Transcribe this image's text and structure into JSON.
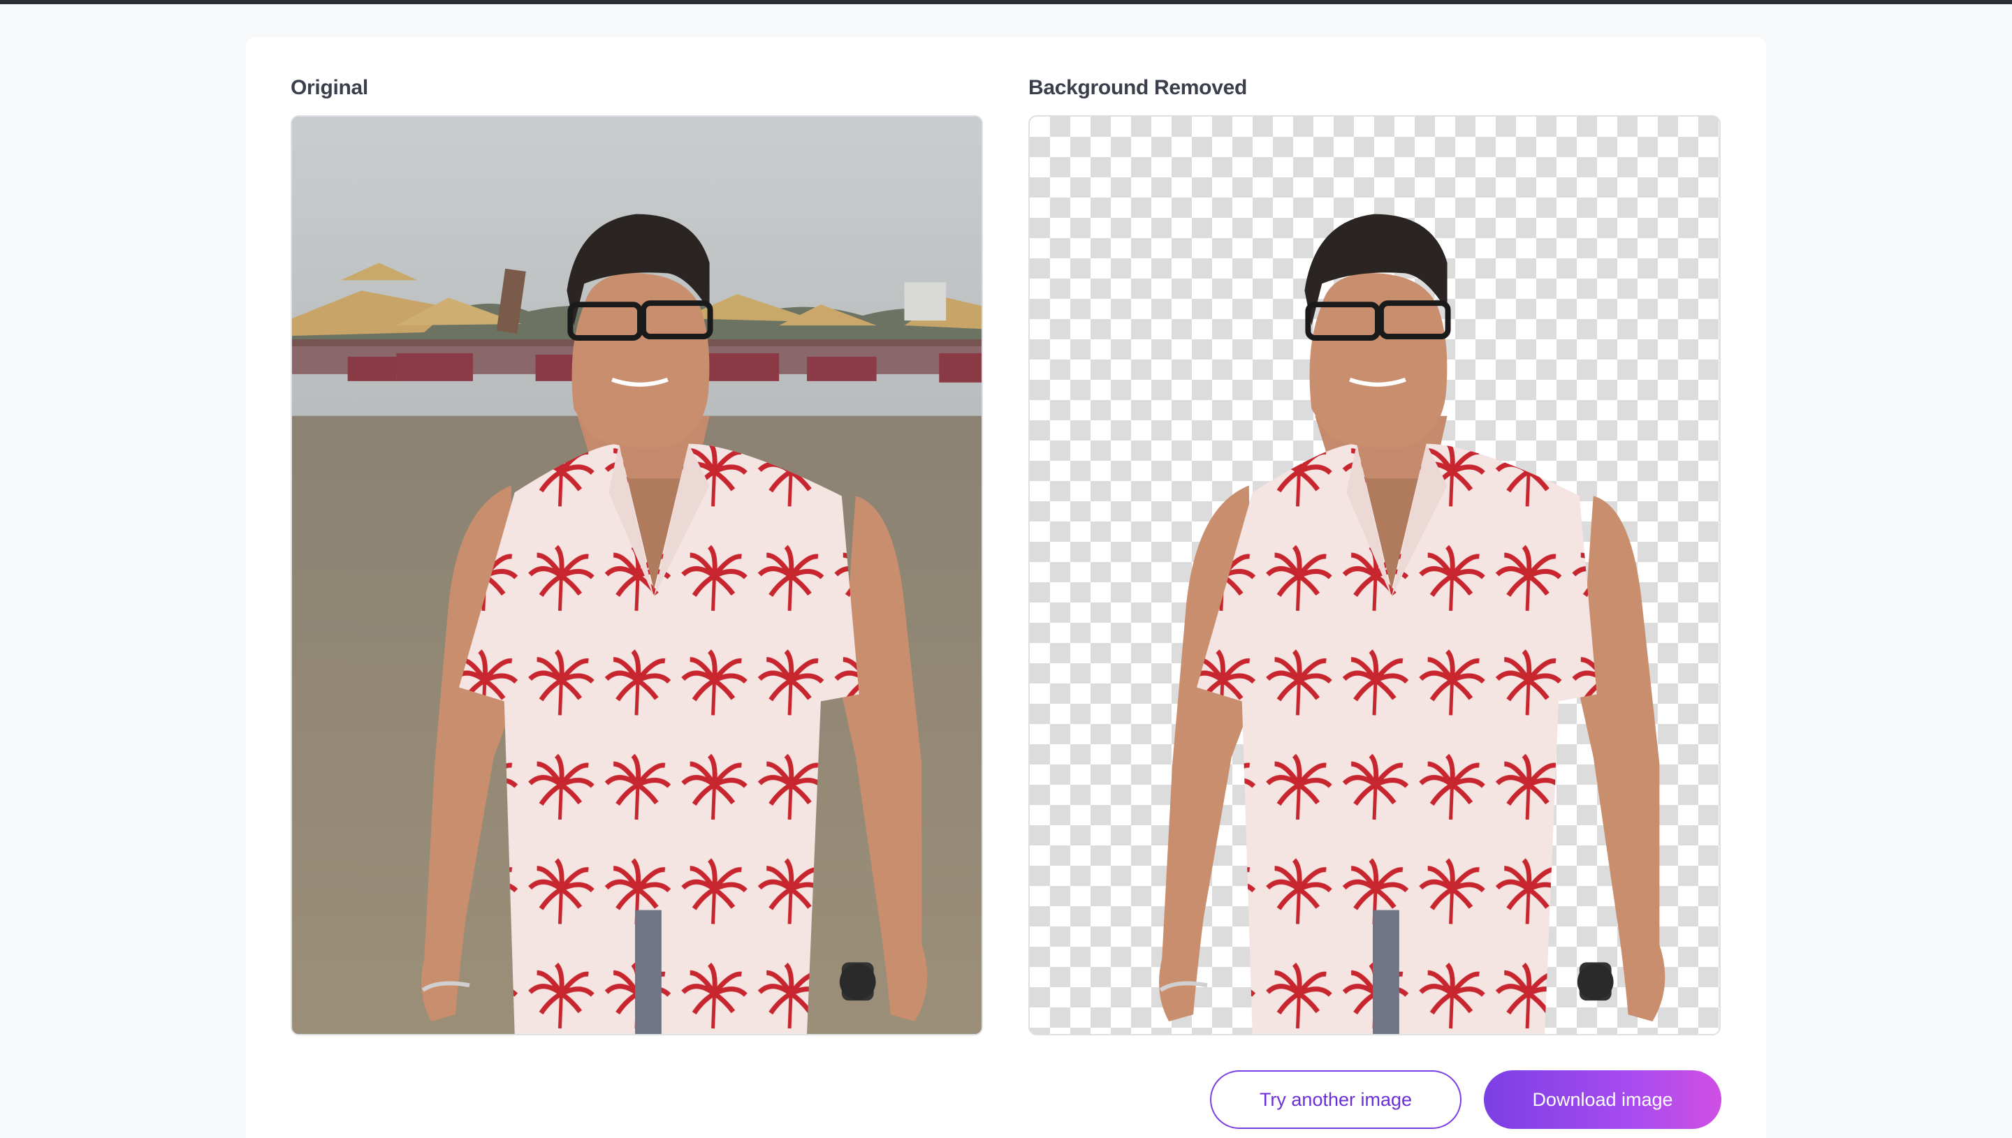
{
  "panels": {
    "original": {
      "title": "Original"
    },
    "removed": {
      "title": "Background Removed"
    }
  },
  "actions": {
    "try_another_label": "Try another image",
    "download_label": "Download image"
  },
  "colors": {
    "accent": "#7b3fe4",
    "accent_end": "#cf4fe3",
    "title_text": "#3a3f4b",
    "shirt_print": "#c8262e"
  },
  "icons": []
}
